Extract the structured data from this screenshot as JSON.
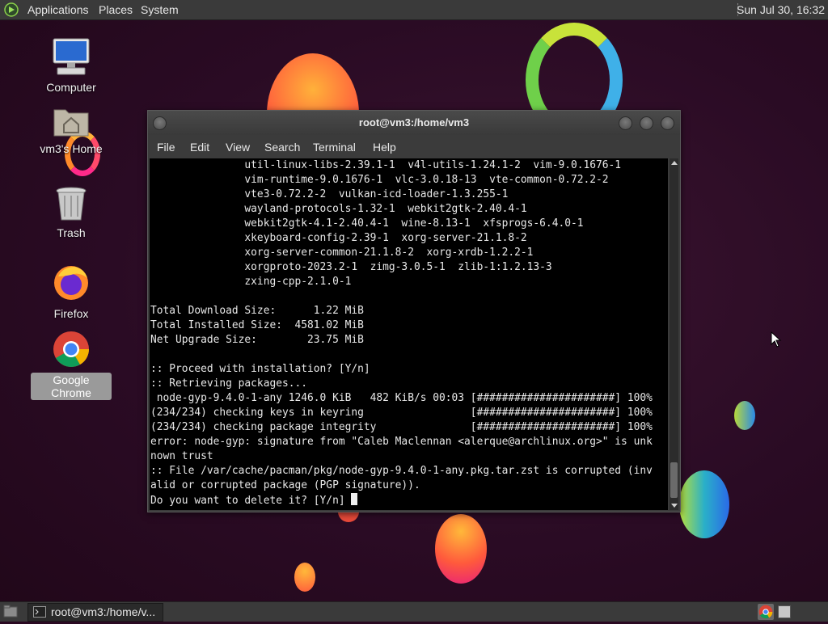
{
  "top_panel": {
    "menus": [
      "Applications",
      "Places",
      "System"
    ],
    "clock": "Sun Jul 30, 16:32"
  },
  "desktop_icons": [
    {
      "name": "computer",
      "label": "Computer",
      "icon": "computer-icon"
    },
    {
      "name": "home",
      "label": "vm3's Home",
      "icon": "home-folder-icon"
    },
    {
      "name": "trash",
      "label": "Trash",
      "icon": "trash-icon"
    },
    {
      "name": "firefox",
      "label": "Firefox",
      "icon": "firefox-icon"
    },
    {
      "name": "chrome",
      "label": "Google Chrome",
      "icon": "chrome-icon",
      "selected": true
    }
  ],
  "terminal": {
    "title": "root@vm3:/home/vm3",
    "menu": [
      "File",
      "Edit",
      "View",
      "Search",
      "Terminal",
      "Help"
    ],
    "lines": [
      "               util-linux-libs-2.39.1-1  v4l-utils-1.24.1-2  vim-9.0.1676-1",
      "               vim-runtime-9.0.1676-1  vlc-3.0.18-13  vte-common-0.72.2-2",
      "               vte3-0.72.2-2  vulkan-icd-loader-1.3.255-1",
      "               wayland-protocols-1.32-1  webkit2gtk-2.40.4-1",
      "               webkit2gtk-4.1-2.40.4-1  wine-8.13-1  xfsprogs-6.4.0-1",
      "               xkeyboard-config-2.39-1  xorg-server-21.1.8-2",
      "               xorg-server-common-21.1.8-2  xorg-xrdb-1.2.2-1",
      "               xorgproto-2023.2-1  zimg-3.0.5-1  zlib-1:1.2.13-3",
      "               zxing-cpp-2.1.0-1",
      "",
      "Total Download Size:      1.22 MiB",
      "Total Installed Size:  4581.02 MiB",
      "Net Upgrade Size:        23.75 MiB",
      "",
      ":: Proceed with installation? [Y/n]",
      ":: Retrieving packages...",
      " node-gyp-9.4.0-1-any 1246.0 KiB   482 KiB/s 00:03 [######################] 100%",
      "(234/234) checking keys in keyring                 [######################] 100%",
      "(234/234) checking package integrity               [######################] 100%",
      "error: node-gyp: signature from \"Caleb Maclennan <alerque@archlinux.org>\" is unk",
      "nown trust",
      ":: File /var/cache/pacman/pkg/node-gyp-9.4.0-1-any.pkg.tar.zst is corrupted (inv",
      "alid or corrupted package (PGP signature)).",
      "Do you want to delete it? [Y/n] "
    ]
  },
  "taskbar": {
    "show_desktop_icon": "show-desktop-icon",
    "task_label": "root@vm3:/home/v...",
    "tray": [
      "chrome-icon",
      "workspace-switcher-icon"
    ]
  }
}
